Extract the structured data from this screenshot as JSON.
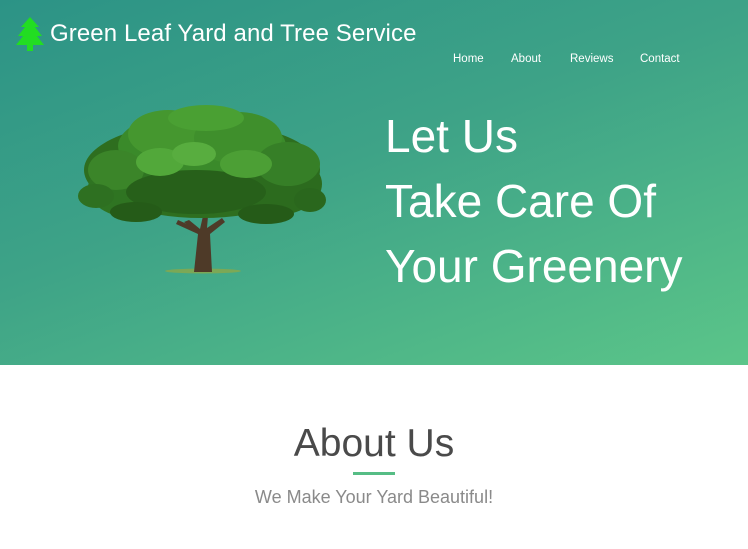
{
  "brand": {
    "name": "Green Leaf Yard and Tree Service",
    "icon": "pine-tree-icon",
    "icon_color": "#22dd22"
  },
  "nav": {
    "items": [
      {
        "label": "Home"
      },
      {
        "label": "About"
      },
      {
        "label": "Reviews"
      },
      {
        "label": "Contact"
      }
    ]
  },
  "hero": {
    "headline_lines": [
      "Let Us",
      "Take Care Of",
      "Your Greenery"
    ],
    "image": "oak-tree-illustration",
    "gradient_start": "#2c9386",
    "gradient_end": "#5bc589"
  },
  "about": {
    "title": "About Us",
    "subtitle": "We Make Your Yard Beautiful!",
    "accent_color": "#56bd85"
  }
}
